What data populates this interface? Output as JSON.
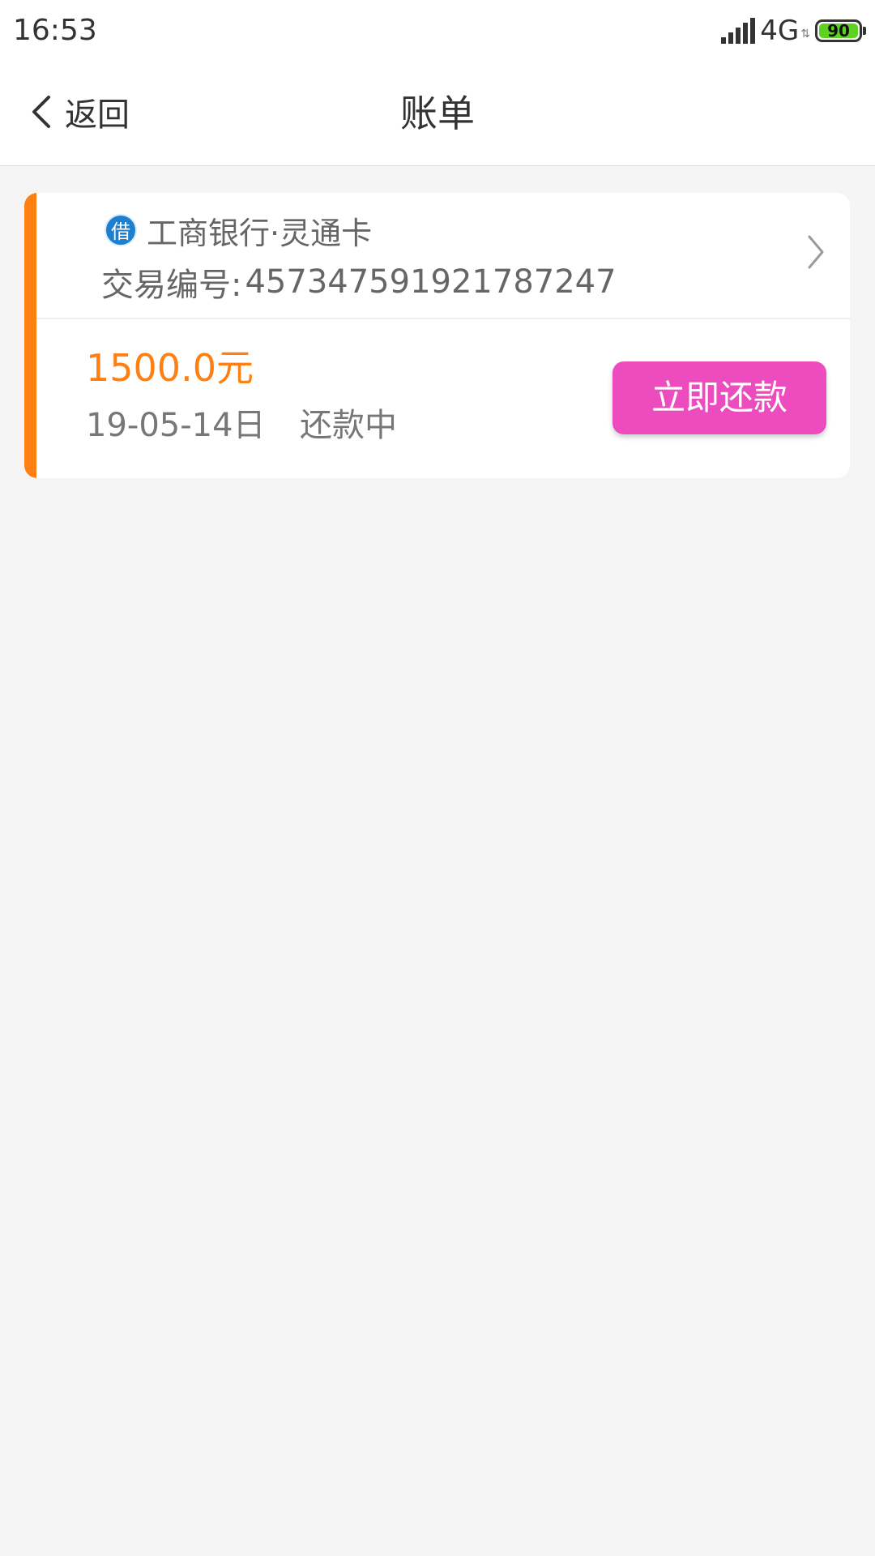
{
  "status_bar": {
    "time": "16:53",
    "network": "4G",
    "data_arrows": "⇅",
    "battery_level": "90"
  },
  "nav": {
    "back_label": "返回",
    "title": "账单"
  },
  "bill": {
    "loan_icon_char": "借",
    "bank_name": "工商银行·灵通卡",
    "trade_label": "交易编号:",
    "trade_number": "457347591921787247",
    "amount": "1500.0元",
    "date": "19-05-14日",
    "status": "还款中",
    "repay_button_label": "立即还款"
  },
  "colors": {
    "accent": "#ff7f12",
    "repay_button": "#ec4cbe",
    "battery": "#5cd321",
    "loan_icon": "#1f7fcf"
  }
}
